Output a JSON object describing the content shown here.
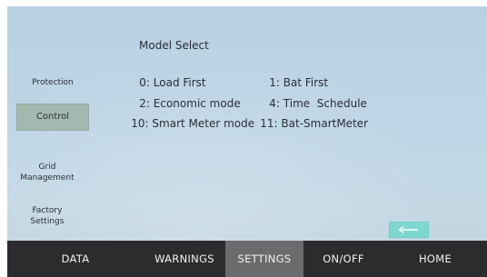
{
  "sidebar": {
    "items": [
      {
        "label": "Protection"
      },
      {
        "label": "Control"
      },
      {
        "label": "Grid\nManagement"
      },
      {
        "label": "Factory\nSettings"
      }
    ]
  },
  "main": {
    "title": "Model Select",
    "options": [
      {
        "code": "0:",
        "label": "Load First"
      },
      {
        "code": "1:",
        "label": "Bat First"
      },
      {
        "code": "2:",
        "label": "Economic mode"
      },
      {
        "code": "4:",
        "label": "Time  Schedule"
      },
      {
        "code": "10:",
        "label": "Smart Meter mode"
      },
      {
        "code": "11:",
        "label": "Bat-SmartMeter"
      }
    ]
  },
  "back_button": {
    "icon": "arrow-left-icon",
    "color": "#7fd8d0"
  },
  "nav": {
    "tabs": [
      {
        "label": "DATA"
      },
      {
        "label": "WARNINGS"
      },
      {
        "label": "SETTINGS"
      },
      {
        "label": "ON/OFF"
      },
      {
        "label": "HOME"
      }
    ],
    "active": "SETTINGS"
  }
}
